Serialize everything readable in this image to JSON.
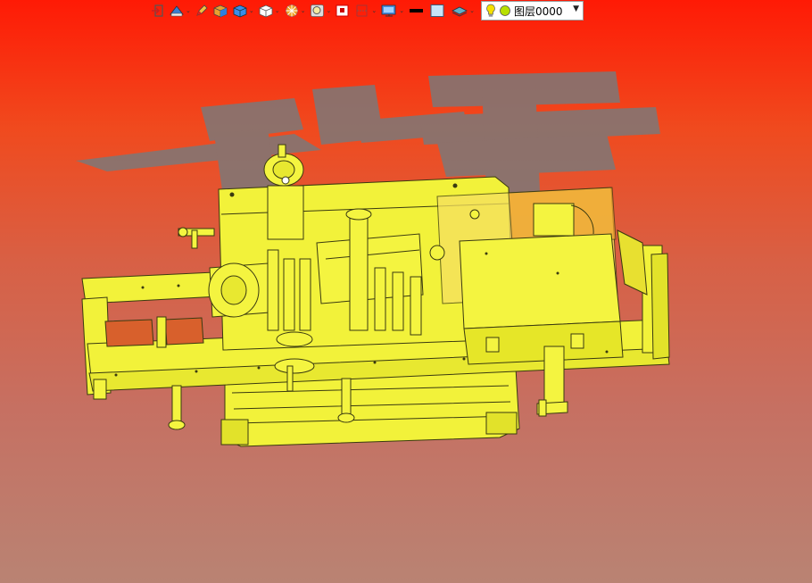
{
  "toolbar": {
    "items": [
      {
        "icon": "exit-icon"
      },
      {
        "icon": "render-mode-icon",
        "dropdown": true
      },
      {
        "icon": "pencil-icon"
      },
      {
        "icon": "texture-cube-icon"
      },
      {
        "icon": "solid-cube-icon",
        "dropdown": true
      },
      {
        "icon": "wire-cube-icon",
        "dropdown": true
      },
      {
        "icon": "light-icon",
        "dropdown": true
      },
      {
        "icon": "zoom-icon",
        "dropdown": true
      },
      {
        "icon": "frame-icon"
      },
      {
        "icon": "section-icon",
        "dropdown": true
      },
      {
        "icon": "display-icon",
        "dropdown": true
      },
      {
        "icon": "line-color-icon"
      },
      {
        "icon": "fill-color-icon"
      },
      {
        "icon": "layer-stack-icon",
        "dropdown": true
      }
    ],
    "layer": {
      "label": "图层0000",
      "status_colors": {
        "bulb": "#f5e000",
        "dot": "#b8e000"
      }
    }
  },
  "viewport": {
    "background_top": "#ff1a05",
    "background_bottom": "#b98373",
    "model_color": "#f2f23a",
    "model_edge": "#3a3a10",
    "watermark_color": "#7a7a7a"
  }
}
